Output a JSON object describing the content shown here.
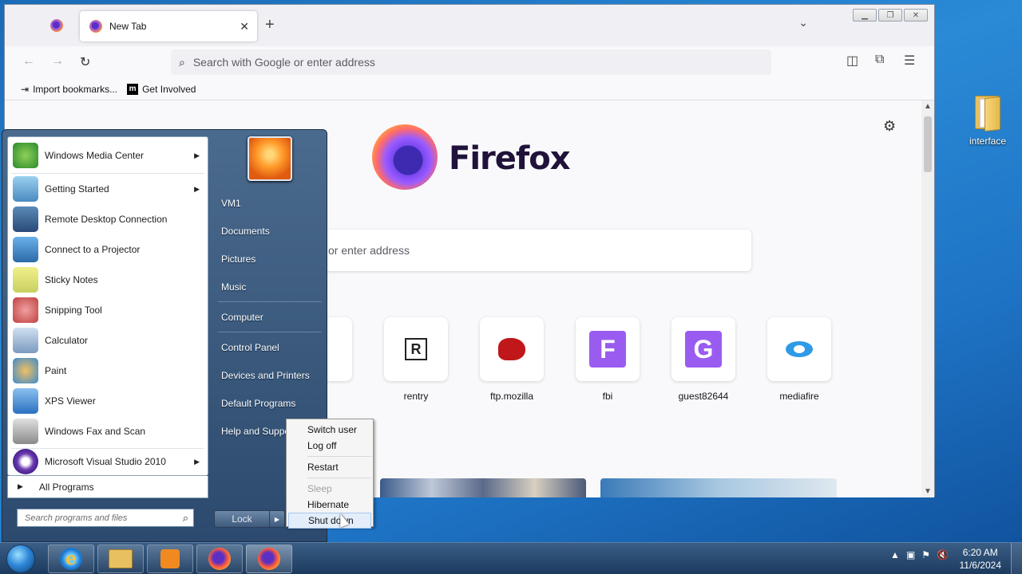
{
  "desktop": {
    "icon_label": "interface"
  },
  "browser": {
    "tab_title": "New Tab",
    "new_tab": "+",
    "url_placeholder": "Search with Google or enter address",
    "bookmarks": [
      "Import bookmarks...",
      "Get Involved"
    ],
    "brand": "Firefox",
    "search_visible_text": "or enter address",
    "tiles": [
      {
        "name": "rentry"
      },
      {
        "name": "ftp.mozilla"
      },
      {
        "name": "fbi"
      },
      {
        "name": "guest82644"
      },
      {
        "name": "mediafire"
      }
    ]
  },
  "start_menu": {
    "programs": [
      {
        "label": "Windows Media Center",
        "submenu": true
      },
      {
        "label": "Getting Started",
        "submenu": true
      },
      {
        "label": "Remote Desktop Connection",
        "submenu": false
      },
      {
        "label": "Connect to a Projector",
        "submenu": false
      },
      {
        "label": "Sticky Notes",
        "submenu": false
      },
      {
        "label": "Snipping Tool",
        "submenu": false
      },
      {
        "label": "Calculator",
        "submenu": false
      },
      {
        "label": "Paint",
        "submenu": false
      },
      {
        "label": "XPS Viewer",
        "submenu": false
      },
      {
        "label": "Windows Fax and Scan",
        "submenu": false
      },
      {
        "label": "Microsoft Visual Studio 2010",
        "submenu": true
      }
    ],
    "all_programs": "All Programs",
    "search_placeholder": "Search programs and files",
    "right_items": [
      "VM1",
      "Documents",
      "Pictures",
      "Music",
      "Computer",
      "Control Panel",
      "Devices and Printers",
      "Default Programs",
      "Help and Support"
    ],
    "lock_label": "Lock",
    "power_menu": {
      "items": [
        "Switch user",
        "Log off",
        "Restart",
        "Sleep",
        "Hibernate",
        "Shut down"
      ],
      "disabled": "Sleep",
      "highlighted": "Shut down"
    }
  },
  "taskbar": {
    "time": "6:20 AM",
    "date": "11/6/2024"
  },
  "colors": {
    "firefox_purple": "#7b48f0",
    "start_menu_bg": "#2c4a6e",
    "taskbar_bg": "#1c3a5e"
  }
}
